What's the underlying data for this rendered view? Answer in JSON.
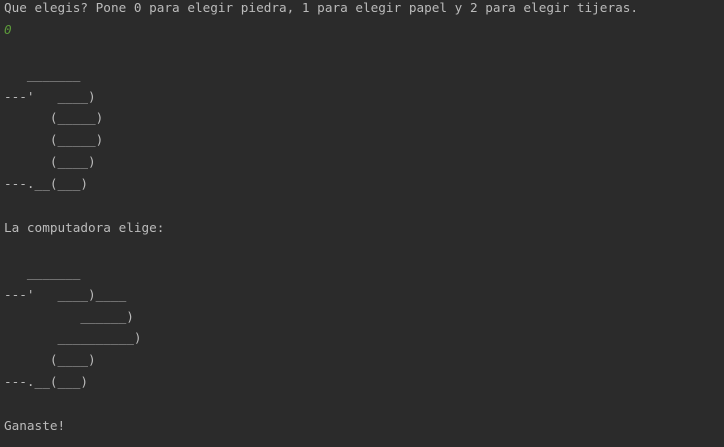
{
  "console": {
    "prompt": "Que elegis? Pone 0 para elegir piedra, 1 para elegir papel y 2 para elegir tijeras.",
    "user_input": "0",
    "player_art": [
      "   _______",
      "---'   ____)",
      "      (_____)",
      "      (_____)",
      "      (____)",
      "---.__(___)"
    ],
    "computer_label": "La computadora elige:",
    "computer_art": [
      "   _______",
      "---'   ____)____",
      "          ______)",
      "       __________)",
      "      (____)",
      "---.__(___)"
    ],
    "result": "Ganaste!"
  }
}
